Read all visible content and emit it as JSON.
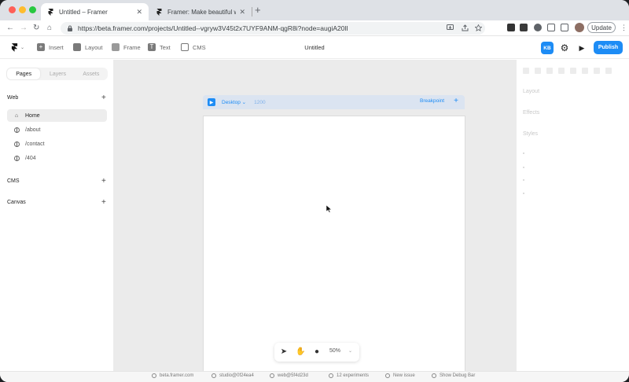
{
  "browser": {
    "tabs": [
      {
        "title": "Untitled – Framer",
        "active": true,
        "icon": "framer-logo-icon"
      },
      {
        "title": "Framer: Make beautiful websit",
        "active": false,
        "icon": "framer-logo-icon"
      }
    ],
    "new_tab_label": "+",
    "url": "https://beta.framer.com/projects/Untitled--vgryw3V45t2x7UYF9ANM-qgR8i?node=augiA20lI",
    "update_label": "Update",
    "traffic_lights": {
      "close": "#ff5f57",
      "minimize": "#febc2e",
      "maximize": "#28c840"
    }
  },
  "framer_topbar": {
    "tools": [
      {
        "label": "Insert",
        "icon": "plus-square-icon"
      },
      {
        "label": "Layout",
        "icon": "layout-icon"
      },
      {
        "label": "Frame",
        "icon": "frame-icon"
      },
      {
        "label": "Text",
        "icon": "text-icon"
      },
      {
        "label": "CMS",
        "icon": "database-icon"
      }
    ],
    "document_title": "Untitled",
    "user_initials": "KB",
    "publish_label": "Publish",
    "accent_color": "#1d8cf5"
  },
  "left_panel": {
    "tabs": [
      {
        "label": "Pages",
        "active": true
      },
      {
        "label": "Layers",
        "active": false
      },
      {
        "label": "Assets",
        "active": false
      }
    ],
    "sections": {
      "web": "Web",
      "cms": "CMS",
      "canvas": "Canvas"
    },
    "pages": [
      {
        "label": "Home",
        "icon": "home-icon",
        "selected": true
      },
      {
        "label": "/about",
        "icon": "globe-icon",
        "selected": false
      },
      {
        "label": "/contact",
        "icon": "globe-icon",
        "selected": false
      },
      {
        "label": "/404",
        "icon": "globe-icon",
        "selected": false
      }
    ]
  },
  "canvas": {
    "breakpoint_name": "Desktop ⌄",
    "breakpoint_width": "1200",
    "breakpoint_add_label": "Breakpoint",
    "zoom": "50%"
  },
  "right_panel": {
    "labels": [
      "Layout",
      "Effects",
      "Styles"
    ]
  },
  "footer": {
    "items": [
      {
        "label": "beta.framer.com",
        "icon": "globe-icon"
      },
      {
        "label": "studio@0f24ea4",
        "icon": "branch-icon"
      },
      {
        "label": "web@5f4d23d",
        "icon": "link-icon"
      },
      {
        "label": "12 experiments",
        "icon": "flask-icon"
      },
      {
        "label": "New issue",
        "icon": "plus-icon"
      },
      {
        "label": "Show Debug Bar",
        "icon": "pulse-icon"
      }
    ]
  }
}
